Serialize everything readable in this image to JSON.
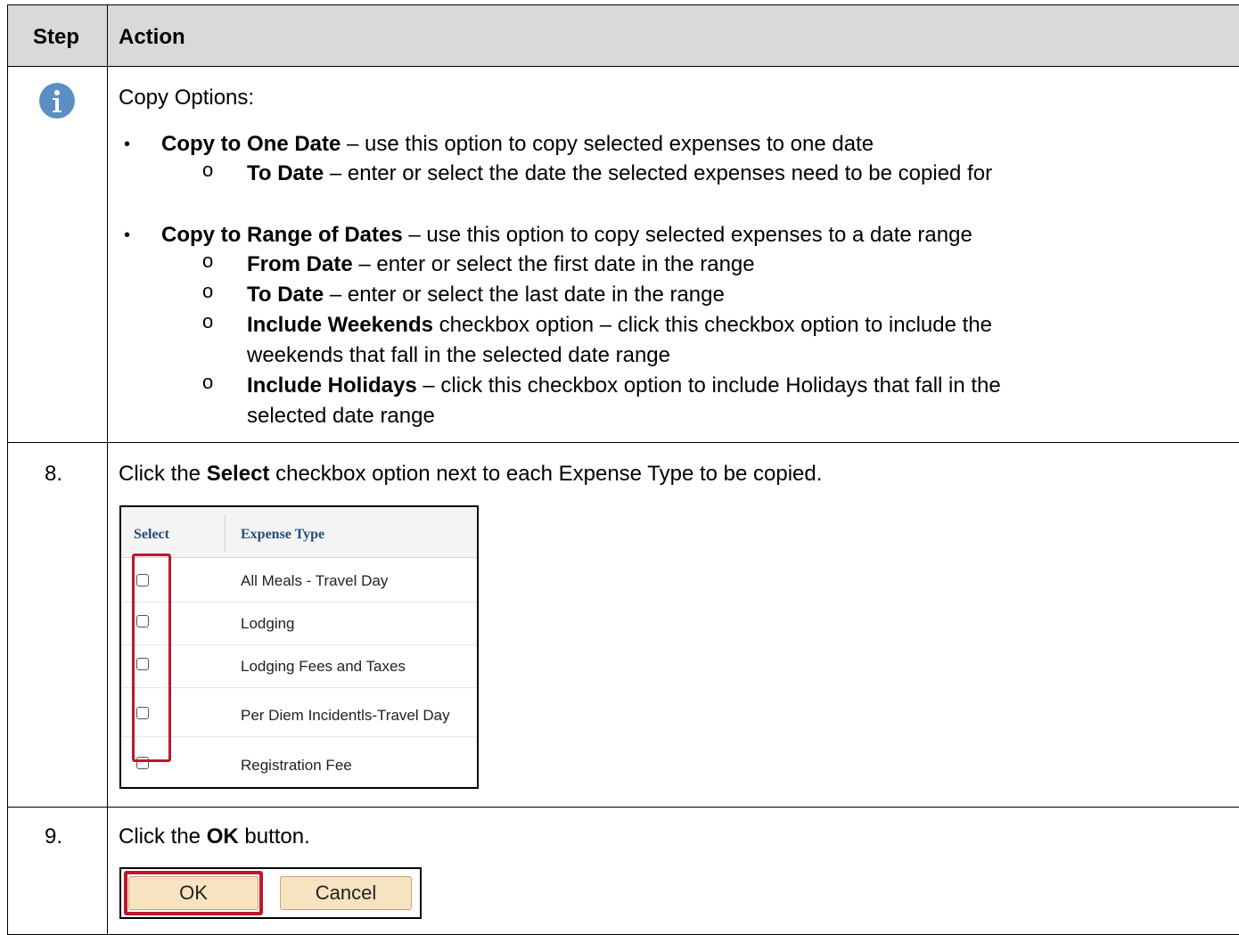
{
  "header": {
    "step": "Step",
    "action": "Action"
  },
  "info": {
    "intro": "Copy Options:",
    "opt1": {
      "title": "Copy to One Date",
      "text": " – use this option to copy selected expenses to one date"
    },
    "opt1_sub": {
      "title": "To Date",
      "text": " – enter or select the date the selected expenses need to be copied for"
    },
    "opt2": {
      "title": "Copy to Range of Dates",
      "text": " – use this option to copy selected expenses to a date range"
    },
    "opt2_subs": [
      {
        "title": "From Date",
        "text": " – enter or select the first date in the range",
        "cont": ""
      },
      {
        "title": "To Date",
        "text": " – enter or select the last date in the range",
        "cont": ""
      },
      {
        "title": "Include Weekends",
        "text": " checkbox option – click this checkbox option to include the",
        "cont": "weekends that fall in the selected date range"
      },
      {
        "title": "Include Holidays",
        "text": " – click this checkbox option to include Holidays that fall in the",
        "cont": "selected date range"
      }
    ]
  },
  "step8": {
    "num": "8.",
    "pre": "Click the ",
    "bold": "Select",
    "post": " checkbox option next to each Expense Type to be copied.",
    "table": {
      "col_select": "Select",
      "col_type": "Expense Type",
      "rows": [
        "All Meals - Travel Day",
        "Lodging",
        "Lodging Fees and Taxes",
        "Per Diem Incidentls-Travel Day",
        "Registration Fee"
      ]
    }
  },
  "step9": {
    "num": "9.",
    "pre": "Click the ",
    "bold": "OK",
    "post": " button.",
    "ok_label": "OK",
    "cancel_label": "Cancel"
  },
  "colors": {
    "header_bg": "#d9d9d9",
    "highlight": "#c0162c",
    "info_icon": "#5b8fc4",
    "button_bg": "#f7e3c0"
  }
}
